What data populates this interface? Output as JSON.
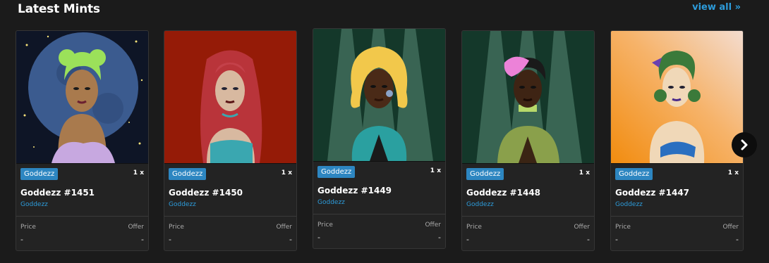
{
  "section": {
    "title": "Latest Mints",
    "view_all": "view all »"
  },
  "cards": [
    {
      "tag": "Goddezz",
      "qty": "1 x",
      "name": "Goddezz #1451",
      "collection": "Goddezz",
      "price_label": "Price",
      "offer_label": "Offer",
      "price": "-",
      "offer": "-",
      "art": "hair-lime-green-moon-background"
    },
    {
      "tag": "Goddezz",
      "qty": "1 x",
      "name": "Goddezz #1450",
      "collection": "Goddezz",
      "price_label": "Price",
      "offer_label": "Offer",
      "price": "-",
      "offer": "-",
      "art": "hair-red-red-background"
    },
    {
      "tag": "Goddezz",
      "qty": "1 x",
      "name": "Goddezz #1449",
      "collection": "Goddezz",
      "price_label": "Price",
      "offer_label": "Offer",
      "price": "-",
      "offer": "-",
      "art": "hair-blonde-spotlight-background"
    },
    {
      "tag": "Goddezz",
      "qty": "1 x",
      "name": "Goddezz #1448",
      "collection": "Goddezz",
      "price_label": "Price",
      "offer_label": "Offer",
      "price": "-",
      "offer": "-",
      "art": "hair-pink-spotlight-background"
    },
    {
      "tag": "Goddezz",
      "qty": "1 x",
      "name": "Goddezz #1447",
      "collection": "Goddezz",
      "price_label": "Price",
      "offer_label": "Offer",
      "price": "-",
      "offer": "-",
      "art": "hair-green-orange-background"
    }
  ],
  "next_button": {
    "icon": "chevron-right-icon"
  },
  "colors": {
    "accent": "#2d9cdb",
    "tag_bg": "#2d86c1",
    "card_bg": "#232323",
    "page_bg": "#1b1b1b"
  }
}
